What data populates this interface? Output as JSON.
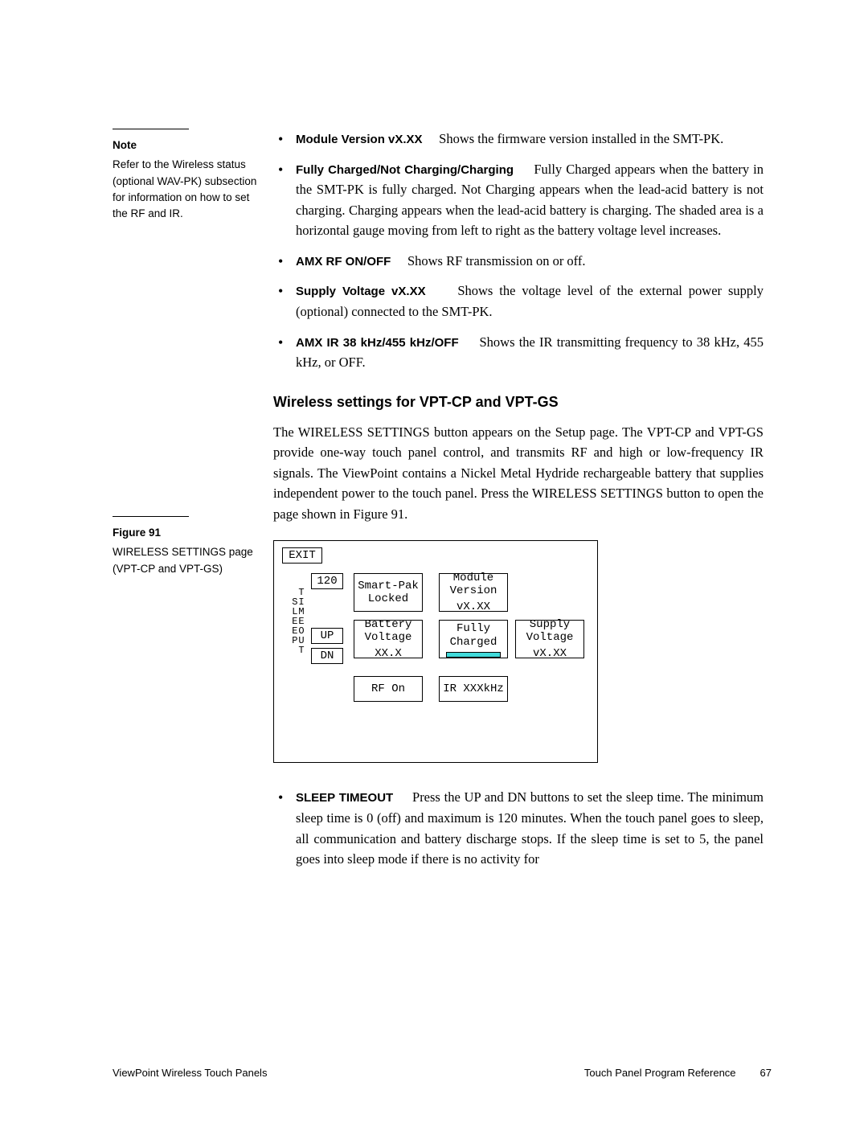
{
  "note": {
    "head": "Note",
    "text": "Refer to the Wireless status (optional WAV-PK) subsection for information on how to set the RF and IR."
  },
  "bullets_top": [
    {
      "term": "Module Version vX.XX",
      "desc": "Shows the firmware version installed in the SMT-PK."
    },
    {
      "term": "Fully Charged/Not Charging/Charging",
      "desc": "Fully Charged appears when the battery in the SMT-PK is fully charged. Not Charging appears when the lead-acid battery is not charging. Charging appears when the lead-acid battery is charging. The shaded area is a horizontal gauge moving from left to right as the battery voltage level increases."
    },
    {
      "term": "AMX RF ON/OFF",
      "desc": "Shows RF transmission on or off."
    },
    {
      "term": "Supply Voltage vX.XX",
      "desc": "Shows the voltage level of the external power supply (optional) connected to the SMT-PK."
    },
    {
      "term": "AMX IR 38 kHz/455 kHz/OFF",
      "desc": "Shows the IR transmitting frequency to 38 kHz, 455 kHz, or OFF."
    }
  ],
  "section_heading": "Wireless settings for VPT-CP and VPT-GS",
  "section_para": "The WIRELESS SETTINGS button appears on the Setup page. The VPT-CP and VPT-GS provide one-way touch panel control, and transmits RF and high or low-frequency IR signals. The ViewPoint contains a Nickel Metal Hydride rechargeable battery that supplies independent power to the touch panel. Press the WIRELESS SETTINGS button to open the page shown in Figure 91.",
  "figure_caption": {
    "head": "Figure 91",
    "text": "WIRELESS SETTINGS page (VPT-CP and VPT-GS)"
  },
  "figure": {
    "exit": "EXIT",
    "timeout_value": "120",
    "vlabel": "  T\n SI\n LM\n EE\n EO\n PU\n  T",
    "up": "UP",
    "dn": "DN",
    "smartpak_l1": "Smart-Pak",
    "smartpak_l2": "Locked",
    "module_l1": "Module",
    "module_l2": "Version",
    "module_l3": "vX.XX",
    "battery_l1": "Battery",
    "battery_l2": "Voltage",
    "battery_l3": "XX.X",
    "fully_l1": "Fully",
    "fully_l2": "Charged",
    "supply_l1": "Supply",
    "supply_l2": "Voltage",
    "supply_l3": "vX.XX",
    "rf": "RF On",
    "ir": "IR XXXkHz"
  },
  "bullets_bottom": [
    {
      "term": "SLEEP TIMEOUT",
      "desc": "Press the UP and DN buttons to set the sleep time. The minimum sleep time is 0 (off) and maximum is 120 minutes. When the touch panel goes to sleep, all communication and battery discharge stops. If the sleep time is set to 5, the panel goes into sleep mode if there is no activity for"
    }
  ],
  "footer": {
    "left": "ViewPoint Wireless Touch Panels",
    "right": "Touch Panel Program Reference",
    "page": "67"
  }
}
